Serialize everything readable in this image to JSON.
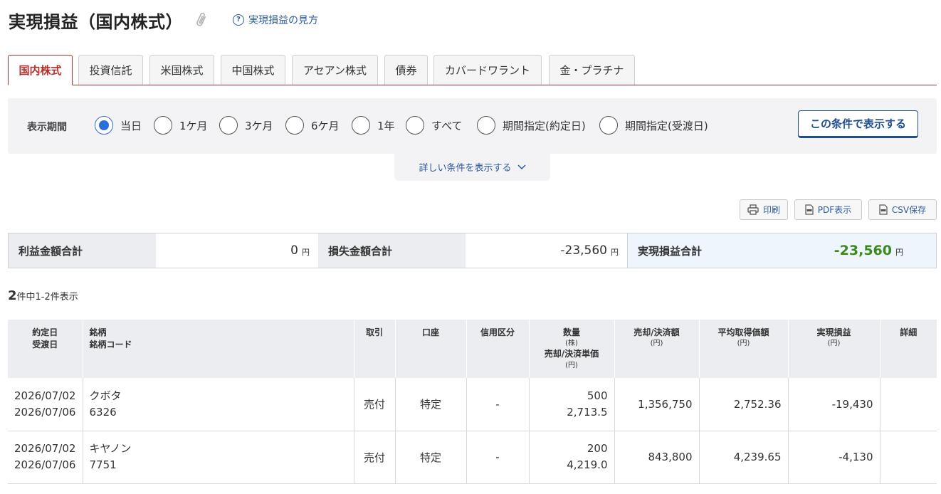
{
  "header": {
    "title": "実現損益（国内株式）",
    "help_link": "実現損益の見方"
  },
  "tabs": [
    "国内株式",
    "投資信託",
    "米国株式",
    "中国株式",
    "アセアン株式",
    "債券",
    "カバードワラント",
    "金・プラチナ"
  ],
  "filter": {
    "label": "表示期間",
    "options": [
      "当日",
      "1ケ月",
      "3ケ月",
      "6ケ月",
      "1年",
      "すべて",
      "期間指定(約定日)",
      "期間指定(受渡日)"
    ],
    "selected": "当日",
    "apply_button": "この条件で表示する",
    "more_conditions": "詳しい条件を表示する"
  },
  "actions": {
    "print": "印刷",
    "pdf": "PDF表示",
    "csv": "CSV保存"
  },
  "summary": {
    "profit_label": "利益金額合計",
    "profit_value": "0",
    "loss_label": "損失金額合計",
    "loss_value": "-23,560",
    "total_label": "実現損益合計",
    "total_value": "-23,560",
    "unit": "円"
  },
  "result_count": {
    "total": "2",
    "text": "件中1-2件表示"
  },
  "table": {
    "headers": {
      "date1": "約定日",
      "date2": "受渡日",
      "name1": "銘柄",
      "name2": "銘柄コード",
      "trade": "取引",
      "account": "口座",
      "margin": "信用区分",
      "qty": "数量",
      "qty_unit": "(株)",
      "price": "売却/決済単価",
      "price_unit": "(円)",
      "amount": "売却/決済額",
      "amount_unit": "(円)",
      "avg": "平均取得価額",
      "avg_unit": "(円)",
      "pl": "実現損益",
      "pl_unit": "(円)",
      "detail": "詳細"
    },
    "rows": [
      {
        "trade_date": "2026/07/02",
        "settle_date": "2026/07/06",
        "name": "クボタ",
        "code": "6326",
        "trade": "売付",
        "account": "特定",
        "margin": "-",
        "qty": "500",
        "price": "2,713.5",
        "amount": "1,356,750",
        "avg": "2,752.36",
        "pl": "-19,430"
      },
      {
        "trade_date": "2026/07/02",
        "settle_date": "2026/07/06",
        "name": "キヤノン",
        "code": "7751",
        "trade": "売付",
        "account": "特定",
        "margin": "-",
        "qty": "200",
        "price": "4,219.0",
        "amount": "843,800",
        "avg": "4,239.65",
        "pl": "-4,130"
      }
    ]
  }
}
